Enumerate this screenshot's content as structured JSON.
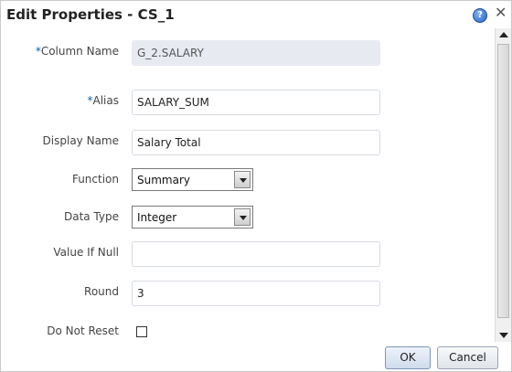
{
  "dialog": {
    "title": "Edit Properties - CS_1",
    "help_glyph": "?",
    "close_glyph": "✕"
  },
  "form": {
    "required_marker": "*",
    "fields": [
      {
        "label": "Column Name",
        "required": true,
        "value": "G_2.SALARY",
        "type": "readonly"
      },
      {
        "label": "Alias",
        "required": true,
        "value": "SALARY_SUM",
        "type": "text"
      },
      {
        "label": "Display Name",
        "required": false,
        "value": "Salary Total",
        "type": "text"
      },
      {
        "label": "Function",
        "required": false,
        "value": "Summary",
        "type": "select"
      },
      {
        "label": "Data Type",
        "required": false,
        "value": "Integer",
        "type": "select"
      },
      {
        "label": "Value If Null",
        "required": false,
        "value": "",
        "type": "text"
      },
      {
        "label": "Round",
        "required": false,
        "value": "3",
        "type": "text"
      },
      {
        "label": "Do Not Reset",
        "required": false,
        "checked": false,
        "type": "checkbox"
      }
    ]
  },
  "buttons": {
    "ok_label": "OK",
    "cancel_label": "Cancel"
  },
  "icons": {
    "help": "help-icon",
    "close": "close-icon",
    "dropdown": "chevron-down-icon"
  },
  "colors": {
    "required_marker": "#0a5dbd",
    "readonly_bg": "#e8eaf2",
    "help_icon": "#2a62c9"
  }
}
